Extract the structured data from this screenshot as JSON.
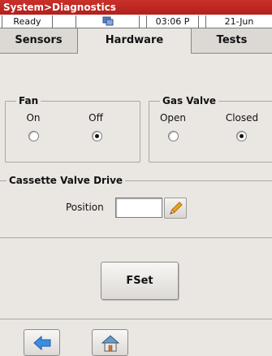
{
  "title": "System>Diagnostics",
  "status": {
    "state": "Ready",
    "network_icon": "network-status-icon",
    "time": "03:06 P",
    "date": "21-Jun"
  },
  "tabs": [
    {
      "label": "Sensors",
      "active": false
    },
    {
      "label": "Hardware",
      "active": true
    },
    {
      "label": "Tests",
      "active": false
    }
  ],
  "fan": {
    "legend": "Fan",
    "options": [
      {
        "label": "On",
        "selected": false
      },
      {
        "label": "Off",
        "selected": true
      }
    ]
  },
  "gas_valve": {
    "legend": "Gas Valve",
    "options": [
      {
        "label": "Open",
        "selected": false
      },
      {
        "label": "Closed",
        "selected": true
      }
    ]
  },
  "cassette": {
    "title": "Cassette Valve Drive",
    "position_label": "Position",
    "position_value": ""
  },
  "fset_label": "FSet",
  "nav": {
    "back_icon": "back-arrow-icon",
    "home_icon": "home-icon"
  },
  "colors": {
    "titlebar": "#c0281f",
    "background": "#eae7e3",
    "back_arrow": "#3a8de0",
    "pencil": "#f0a020"
  }
}
